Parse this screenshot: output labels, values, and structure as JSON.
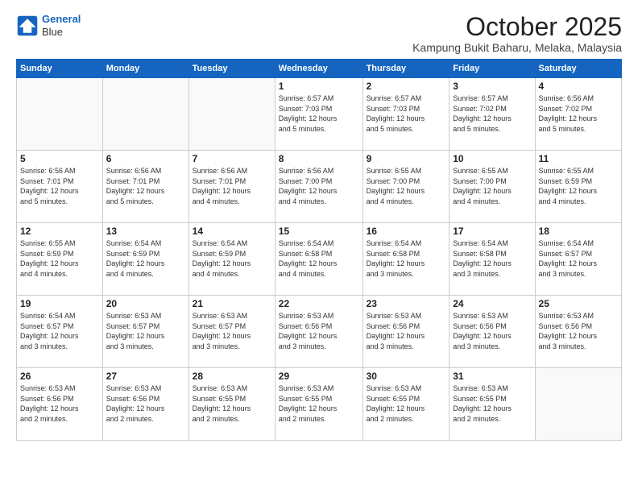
{
  "header": {
    "logo_line1": "General",
    "logo_line2": "Blue",
    "month": "October 2025",
    "location": "Kampung Bukit Baharu, Melaka, Malaysia"
  },
  "days_of_week": [
    "Sunday",
    "Monday",
    "Tuesday",
    "Wednesday",
    "Thursday",
    "Friday",
    "Saturday"
  ],
  "weeks": [
    [
      {
        "day": "",
        "info": ""
      },
      {
        "day": "",
        "info": ""
      },
      {
        "day": "",
        "info": ""
      },
      {
        "day": "1",
        "info": "Sunrise: 6:57 AM\nSunset: 7:03 PM\nDaylight: 12 hours\nand 5 minutes."
      },
      {
        "day": "2",
        "info": "Sunrise: 6:57 AM\nSunset: 7:03 PM\nDaylight: 12 hours\nand 5 minutes."
      },
      {
        "day": "3",
        "info": "Sunrise: 6:57 AM\nSunset: 7:02 PM\nDaylight: 12 hours\nand 5 minutes."
      },
      {
        "day": "4",
        "info": "Sunrise: 6:56 AM\nSunset: 7:02 PM\nDaylight: 12 hours\nand 5 minutes."
      }
    ],
    [
      {
        "day": "5",
        "info": "Sunrise: 6:56 AM\nSunset: 7:01 PM\nDaylight: 12 hours\nand 5 minutes."
      },
      {
        "day": "6",
        "info": "Sunrise: 6:56 AM\nSunset: 7:01 PM\nDaylight: 12 hours\nand 5 minutes."
      },
      {
        "day": "7",
        "info": "Sunrise: 6:56 AM\nSunset: 7:01 PM\nDaylight: 12 hours\nand 4 minutes."
      },
      {
        "day": "8",
        "info": "Sunrise: 6:56 AM\nSunset: 7:00 PM\nDaylight: 12 hours\nand 4 minutes."
      },
      {
        "day": "9",
        "info": "Sunrise: 6:55 AM\nSunset: 7:00 PM\nDaylight: 12 hours\nand 4 minutes."
      },
      {
        "day": "10",
        "info": "Sunrise: 6:55 AM\nSunset: 7:00 PM\nDaylight: 12 hours\nand 4 minutes."
      },
      {
        "day": "11",
        "info": "Sunrise: 6:55 AM\nSunset: 6:59 PM\nDaylight: 12 hours\nand 4 minutes."
      }
    ],
    [
      {
        "day": "12",
        "info": "Sunrise: 6:55 AM\nSunset: 6:59 PM\nDaylight: 12 hours\nand 4 minutes."
      },
      {
        "day": "13",
        "info": "Sunrise: 6:54 AM\nSunset: 6:59 PM\nDaylight: 12 hours\nand 4 minutes."
      },
      {
        "day": "14",
        "info": "Sunrise: 6:54 AM\nSunset: 6:59 PM\nDaylight: 12 hours\nand 4 minutes."
      },
      {
        "day": "15",
        "info": "Sunrise: 6:54 AM\nSunset: 6:58 PM\nDaylight: 12 hours\nand 4 minutes."
      },
      {
        "day": "16",
        "info": "Sunrise: 6:54 AM\nSunset: 6:58 PM\nDaylight: 12 hours\nand 3 minutes."
      },
      {
        "day": "17",
        "info": "Sunrise: 6:54 AM\nSunset: 6:58 PM\nDaylight: 12 hours\nand 3 minutes."
      },
      {
        "day": "18",
        "info": "Sunrise: 6:54 AM\nSunset: 6:57 PM\nDaylight: 12 hours\nand 3 minutes."
      }
    ],
    [
      {
        "day": "19",
        "info": "Sunrise: 6:54 AM\nSunset: 6:57 PM\nDaylight: 12 hours\nand 3 minutes."
      },
      {
        "day": "20",
        "info": "Sunrise: 6:53 AM\nSunset: 6:57 PM\nDaylight: 12 hours\nand 3 minutes."
      },
      {
        "day": "21",
        "info": "Sunrise: 6:53 AM\nSunset: 6:57 PM\nDaylight: 12 hours\nand 3 minutes."
      },
      {
        "day": "22",
        "info": "Sunrise: 6:53 AM\nSunset: 6:56 PM\nDaylight: 12 hours\nand 3 minutes."
      },
      {
        "day": "23",
        "info": "Sunrise: 6:53 AM\nSunset: 6:56 PM\nDaylight: 12 hours\nand 3 minutes."
      },
      {
        "day": "24",
        "info": "Sunrise: 6:53 AM\nSunset: 6:56 PM\nDaylight: 12 hours\nand 3 minutes."
      },
      {
        "day": "25",
        "info": "Sunrise: 6:53 AM\nSunset: 6:56 PM\nDaylight: 12 hours\nand 3 minutes."
      }
    ],
    [
      {
        "day": "26",
        "info": "Sunrise: 6:53 AM\nSunset: 6:56 PM\nDaylight: 12 hours\nand 2 minutes."
      },
      {
        "day": "27",
        "info": "Sunrise: 6:53 AM\nSunset: 6:56 PM\nDaylight: 12 hours\nand 2 minutes."
      },
      {
        "day": "28",
        "info": "Sunrise: 6:53 AM\nSunset: 6:55 PM\nDaylight: 12 hours\nand 2 minutes."
      },
      {
        "day": "29",
        "info": "Sunrise: 6:53 AM\nSunset: 6:55 PM\nDaylight: 12 hours\nand 2 minutes."
      },
      {
        "day": "30",
        "info": "Sunrise: 6:53 AM\nSunset: 6:55 PM\nDaylight: 12 hours\nand 2 minutes."
      },
      {
        "day": "31",
        "info": "Sunrise: 6:53 AM\nSunset: 6:55 PM\nDaylight: 12 hours\nand 2 minutes."
      },
      {
        "day": "",
        "info": ""
      }
    ]
  ]
}
